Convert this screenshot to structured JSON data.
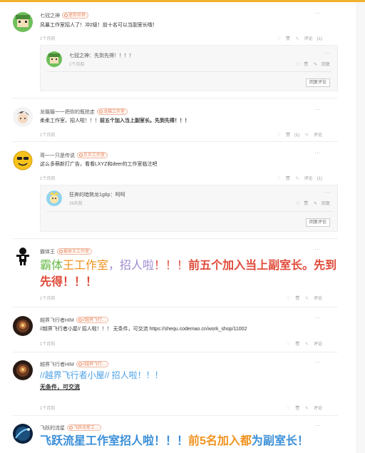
{
  "colors": {
    "accent": "#f2b230",
    "badge": "#e98a64",
    "muted": "#aaaaaa"
  },
  "labels": {
    "like": "赞",
    "comment": "评论",
    "reply": "回复",
    "more": "···",
    "reply_comment": "回复评论"
  },
  "comments": [
    {
      "author": "七冠之神",
      "badge": "迷你世界",
      "text": "风暴工作室招人了！冲2级！前十名可以当副室长哦！",
      "time": "1个月前",
      "likes": "",
      "comments_count": "(1)",
      "replies": [
        {
          "author": "七冠之神：先到先得！！！！",
          "time": "1个月前",
          "action1": "赞",
          "action2": "回复"
        }
      ]
    },
    {
      "author": "龙猫猫一一把你的瓶抢走",
      "badge": "龙猫工作室",
      "text_plain": "柔柔工作室，招人啦！！！",
      "text_bold": "前五个加入当上副室长。先到先得！！！",
      "time": "1个月前",
      "likes": "(1)",
      "comments_count": ""
    },
    {
      "author": "哥一一只是传说",
      "badge": "贝贝工作室",
      "text": "这么多萌新打广告，看看LXYZ和deer的工作室临注吧",
      "time": "1个月前",
      "likes": "",
      "comments_count": "(1)",
      "replies": [
        {
          "author": "狂奔的暗煞龙1g8p：呵呵",
          "time": "26天前",
          "action1": "赞",
          "action2": "回复"
        }
      ]
    },
    {
      "author": "霸体王",
      "badge": "霸体王工作室",
      "rich": [
        {
          "text": "霸体",
          "color": "green"
        },
        {
          "text": "王工作室",
          "color": "orange"
        },
        {
          "text": "，招人啦",
          "color": "purple"
        },
        {
          "text": "！！！",
          "color": "red"
        },
        {
          "text": "前五个加入当上副室长。先到先得！！！",
          "color": "red-bold"
        }
      ],
      "time": "1个月前",
      "likes": "",
      "comments_count": ""
    },
    {
      "author": "越界飞行者HIM",
      "badge": "//越界飞行...",
      "text": "//越界飞行者小屋// 招人啦！！！ 无条件，可交流 https://shequ.codemao.cn/work_shop/11002",
      "time": "1个月前",
      "likes": "",
      "comments_count": ""
    },
    {
      "author": "越界飞行者HIM",
      "badge": "//越界飞行...",
      "text_big": "//越界飞行者小屋//  招人啦！！！",
      "text_sub": "无条件，可交流",
      "time": "1个月前",
      "likes": "",
      "comments_count": ""
    },
    {
      "author": "飞跃的流星",
      "badge": "飞跃流星工...",
      "rich": [
        {
          "text": "飞跃流星工作室招人啦！！！",
          "color": "blue"
        },
        {
          "text": "前5名加入都",
          "color": "orange"
        },
        {
          "text": "为副室长！",
          "color": "blue"
        }
      ]
    }
  ]
}
